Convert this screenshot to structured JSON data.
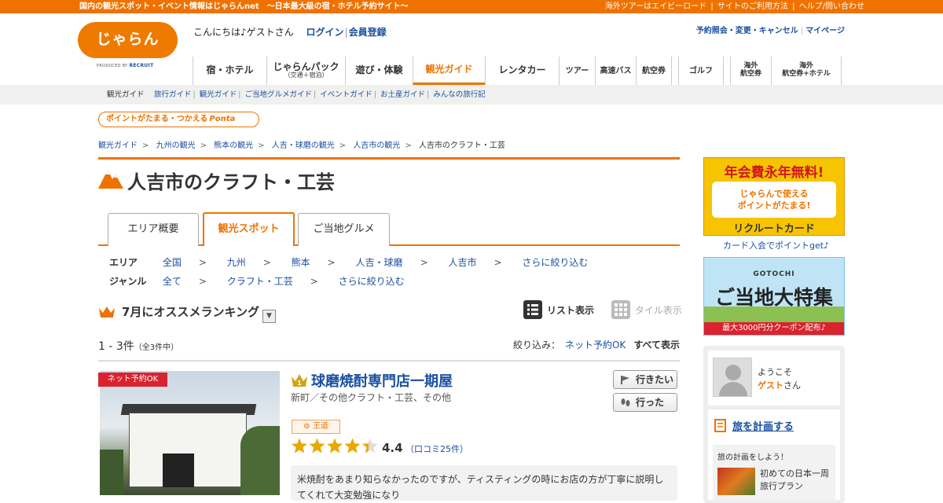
{
  "topbar": {
    "left": "国内の観光スポット・イベント情報はじゃらんnet　～日本最大級の宿・ホテル予約サイト～",
    "links": [
      "海外ツアーはエイビーロード",
      "サイトのご利用方法",
      "ヘルプ/問い合わせ"
    ]
  },
  "logo": {
    "text": "じゃらん",
    "produced": "PRODUCED BY",
    "brand": "RECRUIT"
  },
  "greeting": {
    "text": "こんにちは♪ゲストさん",
    "login": "ログイン",
    "register": "会員登録"
  },
  "account": {
    "reserve": "予約照会・変更・キャンセル",
    "mypage": "マイページ"
  },
  "gnav": [
    {
      "label": "宿・ホテル",
      "sub": ""
    },
    {
      "label": "じゃらんパック",
      "sub": "（交通＋宿泊）"
    },
    {
      "label": "遊び・体験",
      "sub": ""
    },
    {
      "label": "観光ガイド",
      "sub": ""
    },
    {
      "label": "レンタカー",
      "sub": ""
    },
    {
      "label": "ツアー",
      "sub": ""
    },
    {
      "label": "高速バス",
      "sub": ""
    },
    {
      "label": "航空券",
      "sub": ""
    },
    {
      "label": "ゴルフ",
      "sub": ""
    },
    {
      "label": "海外",
      "sub": "航空券"
    },
    {
      "label": "海外",
      "sub": "航空券+ホテル"
    }
  ],
  "subnav": {
    "current": "観光ガイド",
    "links": [
      "旅行ガイド",
      "観光ガイド",
      "ご当地グルメガイド",
      "イベントガイド",
      "お土産ガイド",
      "みんなの旅行記"
    ]
  },
  "ponta": {
    "text": "ポイントがたまる・つかえる",
    "brand": "Ponta"
  },
  "breadcrumb": [
    "観光ガイド",
    "九州の観光",
    "熊本の観光",
    "人吉・球磨の観光",
    "人吉市の観光",
    "人吉市のクラフト・工芸"
  ],
  "page_title": "人吉市のクラフト・工芸",
  "tabs": [
    "エリア概要",
    "観光スポット",
    "ご当地グルメ"
  ],
  "filter": {
    "area_label": "エリア",
    "area": [
      "全国",
      "九州",
      "熊本",
      "人吉・球磨",
      "人吉市",
      "さらに絞り込む"
    ],
    "genre_label": "ジャンル",
    "genre": [
      "全て",
      "クラフト・工芸",
      "さらに絞り込む"
    ]
  },
  "ranking": {
    "title": "7月にオススメランキング",
    "dropdown": "▼"
  },
  "views": {
    "list": "リスト表示",
    "tile": "タイル表示"
  },
  "count": {
    "range": "1 - 3件",
    "total": "（全3件中）"
  },
  "narrow": {
    "label": "絞り込み：",
    "net": "ネット予約OK",
    "all": "すべて表示"
  },
  "spot": {
    "badge": "ネット予約OK",
    "name": "球磨焼酎専門店一期屋",
    "category": "新町／その他クラフト・工芸、その他",
    "want": "行きたい",
    "went": "行った",
    "tag": "王道",
    "rating": 4.4,
    "score": "4.4",
    "reviews": "（口コミ25件）",
    "quote": "米焼酎をあまり知らなかったのですが、ティスティングの時にお店の方が丁寧に説明してくれて大変勉強になり"
  },
  "ad1": {
    "title": "年会費永年無料!",
    "mid1": "じゃらん",
    "mid2": "で使える",
    "mid3": "ポイントがたまる!",
    "bottom": "リクルートカード"
  },
  "ad_link": "カード入会でポイントget♪",
  "ad2": {
    "small": "GOTOCHI",
    "title": "ご当地大特集",
    "bottom": "最大3000円分クーポン配布♪"
  },
  "sidebar": {
    "welcome1": "ようこそ",
    "guest": "ゲスト",
    "san": "さん",
    "plan_title": "旅を計画する",
    "plan_prompt": "旅の計画をしよう！",
    "plan_item1": "初めての日本一周",
    "plan_item2": "旅行プラン"
  },
  "colors": {
    "accent": "#ef7200",
    "link": "#1a4fa0",
    "star": "#e8a800",
    "badge": "#d9232e"
  }
}
